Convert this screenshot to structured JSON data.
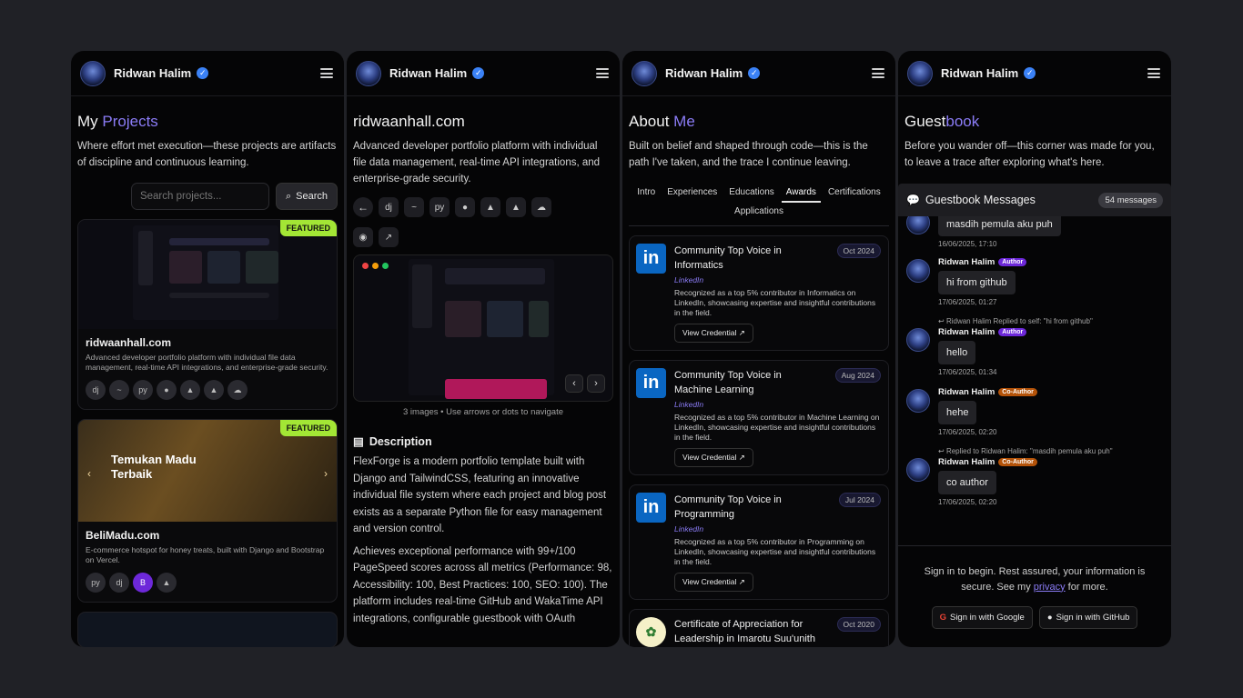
{
  "profile": {
    "name": "Ridwan Halim"
  },
  "projects": {
    "title_plain": "My ",
    "title_accent": "Projects",
    "intro": "Where effort met execution—these projects are artifacts of discipline and continuous learning.",
    "search_placeholder": "Search projects...",
    "search_label": "Search",
    "items": [
      {
        "featured": "FEATURED",
        "name": "ridwaanhall.com",
        "desc": "Advanced developer portfolio platform with individual file data management, real-time API integrations, and enterprise-grade security."
      },
      {
        "featured": "FEATURED",
        "name": "BeliMadu.com",
        "desc": "E-commerce hotspot for honey treats, built with Django and Bootstrap on Vercel.",
        "hero_text": "Temukan Madu Terbaik"
      }
    ]
  },
  "detail": {
    "title": "ridwaanhall.com",
    "summary": "Advanced developer portfolio platform with individual file data management, real-time API integrations, and enterprise-grade security.",
    "gallery_caption": "3 images • Use arrows or dots to navigate",
    "section_title": "Description",
    "p1": "FlexForge is a modern portfolio template built with Django and TailwindCSS, featuring an innovative individual file system where each project and blog post exists as a separate Python file for easy management and version control.",
    "p2": "Achieves exceptional performance with 99+/100 PageSpeed scores across all metrics (Performance: 98, Accessibility: 100, Best Practices: 100, SEO: 100). The platform includes real-time GitHub and WakaTime API integrations, configurable guestbook with OAuth"
  },
  "about": {
    "title_plain": "About ",
    "title_accent": "Me",
    "intro": "Built on belief and shaped through code—this is the path I've taken, and the trace I continue leaving.",
    "tabs": [
      "Intro",
      "Experiences",
      "Educations",
      "Awards",
      "Certifications",
      "Applications"
    ],
    "awards": [
      {
        "title": "Community Top Voice in Informatics",
        "issuer": "LinkedIn",
        "date": "Oct 2024",
        "desc": "Recognized as a top 5% contributor in Informatics on LinkedIn, showcasing expertise and insightful contributions in the field.",
        "cta": "View Credential"
      },
      {
        "title": "Community Top Voice in Machine Learning",
        "issuer": "LinkedIn",
        "date": "Aug 2024",
        "desc": "Recognized as a top 5% contributor in Machine Learning on LinkedIn, showcasing expertise and insightful contributions in the field.",
        "cta": "View Credential"
      },
      {
        "title": "Community Top Voice in Programming",
        "issuer": "LinkedIn",
        "date": "Jul 2024",
        "desc": "Recognized as a top 5% contributor in Programming on LinkedIn, showcasing expertise and insightful contributions in the field.",
        "cta": "View Credential"
      },
      {
        "title": "Certificate of Appreciation for Leadership in Imarotu Suu'unith",
        "date": "Oct 2020"
      }
    ]
  },
  "guestbook": {
    "title_plain": "Guest",
    "title_accent": "book",
    "intro": "Before you wander off—this corner was made for you, to leave a trace after exploring what's here.",
    "header": "Guestbook Messages",
    "count": "54 messages",
    "messages": [
      {
        "text": "masdih pemula aku puh",
        "time": "16/06/2025, 17:10"
      },
      {
        "name": "Ridwan Halim",
        "badge": "Author",
        "text": "hi from github",
        "time": "17/06/2025, 01:27"
      },
      {
        "reply": "Ridwan Halim Replied to self: \"hi from github\"",
        "name": "Ridwan Halim",
        "badge": "Author",
        "text": "hello",
        "time": "17/06/2025, 01:34"
      },
      {
        "name": "Ridwan Halim",
        "badge": "Co-Author",
        "text": "hehe",
        "time": "17/06/2025, 02:20"
      },
      {
        "reply": "Replied to Ridwan Halim: \"masdih pemula aku puh\"",
        "name": "Ridwan Halim",
        "badge": "Co-Author",
        "text": "co author",
        "time": "17/06/2025, 02:20"
      }
    ],
    "signin_pre": "Sign in to begin. Rest assured, your information is secure. See my ",
    "signin_link": "privacy",
    "signin_post": " for more.",
    "google_label": "Sign in with Google",
    "github_label": "Sign in with GitHub"
  },
  "colors": {
    "accent": "#8b7cf6",
    "featured": "#a3e635",
    "linkedin": "#0a66c2",
    "verified": "#3b82f6"
  }
}
